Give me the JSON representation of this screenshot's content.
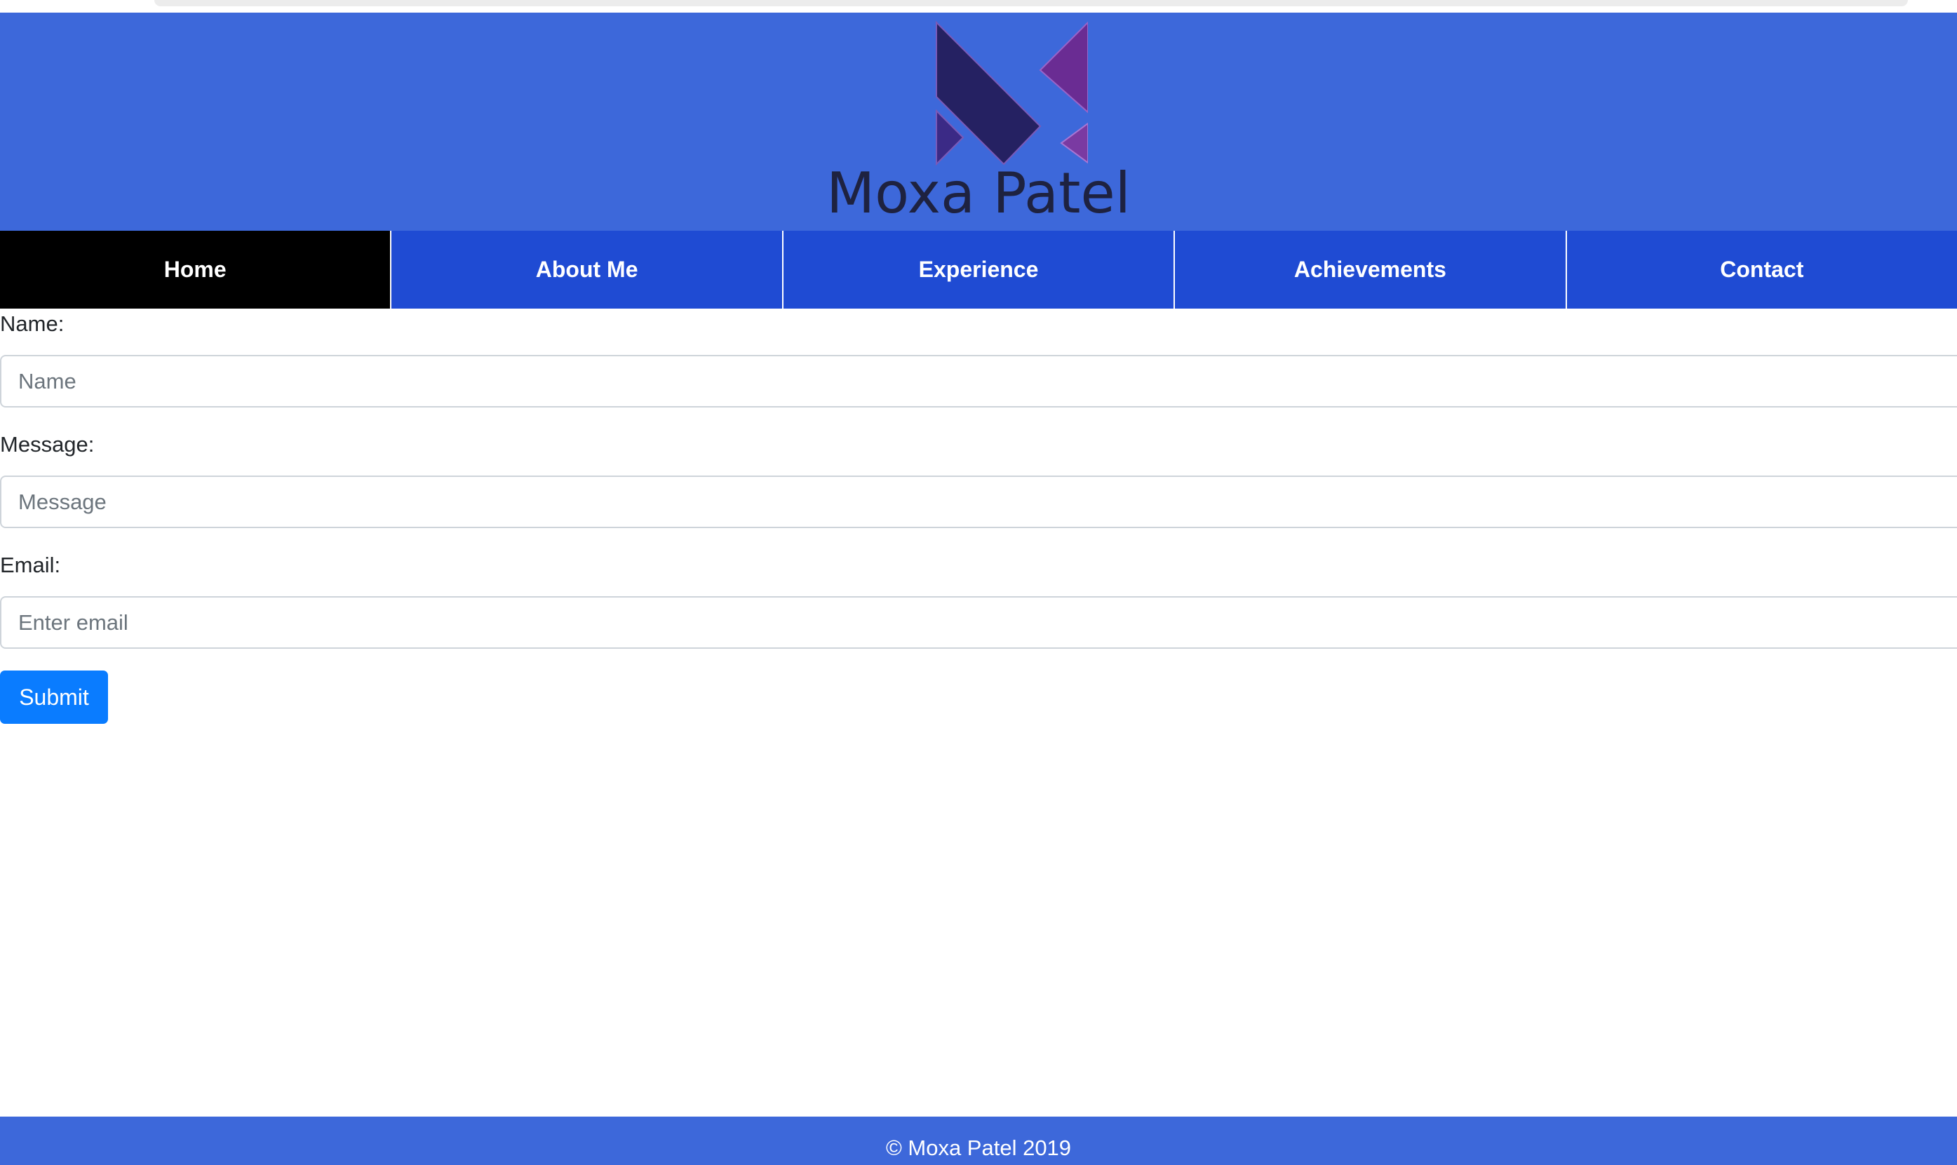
{
  "site": {
    "title": "Moxa Patel",
    "logo_icon": "mp-monogram-logo",
    "colors": {
      "header_bg": "#3d68da",
      "nav_bg": "#1f4bd3",
      "nav_active_bg": "#000000",
      "submit_bg": "#0a7cff"
    }
  },
  "nav": {
    "items": [
      {
        "label": "Home",
        "active": true
      },
      {
        "label": "About Me",
        "active": false
      },
      {
        "label": "Experience",
        "active": false
      },
      {
        "label": "Achievements",
        "active": false
      },
      {
        "label": "Contact",
        "active": false
      }
    ]
  },
  "form": {
    "name": {
      "label": "Name:",
      "placeholder": "Name",
      "value": ""
    },
    "message": {
      "label": "Message:",
      "placeholder": "Message",
      "value": ""
    },
    "email": {
      "label": "Email:",
      "placeholder": "Enter email",
      "value": ""
    },
    "submit_label": "Submit"
  },
  "footer": {
    "text": "© Moxa Patel 2019"
  }
}
